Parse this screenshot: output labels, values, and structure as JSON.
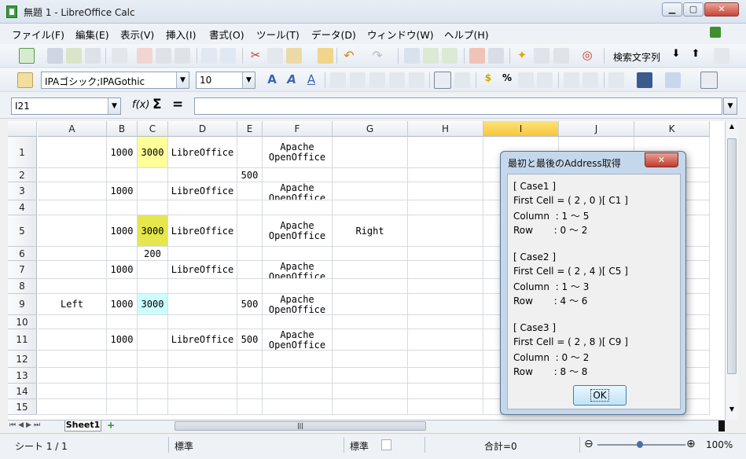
{
  "window": {
    "title": "無題 1 - LibreOffice Calc",
    "minimize": "▁",
    "maximize": "▢",
    "close": "✕"
  },
  "menu": [
    "ファイル(F)",
    "編集(E)",
    "表示(V)",
    "挿入(I)",
    "書式(O)",
    "ツール(T)",
    "データ(D)",
    "ウィンドウ(W)",
    "ヘルプ(H)"
  ],
  "toolbar": {
    "search_label": "検索文字列"
  },
  "format_bar": {
    "font_name": "IPAゴシック;IPAGothic",
    "font_size": "10"
  },
  "formula_bar": {
    "name_box": "I21",
    "fx": "f(x)",
    "sum": "Σ",
    "equals": "=",
    "content": ""
  },
  "columns": [
    "A",
    "B",
    "C",
    "D",
    "E",
    "F",
    "G",
    "H",
    "I",
    "J",
    "K"
  ],
  "selected_column": "I",
  "rows": [
    "1",
    "2",
    "3",
    "4",
    "5",
    "6",
    "7",
    "8",
    "9",
    "10",
    "11",
    "12",
    "13",
    "14",
    "15"
  ],
  "cells": {
    "B1": "1000",
    "C1": "3000",
    "D1": "LibreOffice",
    "F1": "Apache\nOpenOffice",
    "E2": "500",
    "B3": "1000",
    "D3": "LibreOffice",
    "F3": "Apache\nOpenOffice",
    "B5": "1000",
    "C5": "3000",
    "D5": "LibreOffice",
    "F5": "Apache\nOpenOffice",
    "G5": "Right",
    "C6": "200",
    "B7": "1000",
    "D7": "LibreOffice",
    "F7": "Apache\nOpenOffice",
    "A9": "Left",
    "B9": "1000",
    "C9": "3000",
    "E9": "500",
    "F9": "Apache\nOpenOffice",
    "B11": "1000",
    "D11": "LibreOffice",
    "E11": "500",
    "F11": "Apache\nOpenOffice"
  },
  "cell_colors": {
    "C1": "#ffff99",
    "C5": "#e6e64d",
    "C9": "#ccffff"
  },
  "dialog": {
    "title": "最初と最後のAddress取得",
    "close": "✕",
    "lines": [
      "[ Case1 ]",
      "First Cell = ( 2 , 0 )[ C1 ]",
      "Column  : 1 ～ 5",
      "Row       : 0 ～ 2",
      "",
      "[ Case2 ]",
      "First Cell = ( 2 , 4 )[ C5 ]",
      "Column  : 1 ～ 3",
      "Row       : 4 ～ 6",
      "",
      "[ Case3 ]",
      "First Cell = ( 2 , 8 )[ C9 ]",
      "Column  : 0 ～ 2",
      "Row       : 8 ～ 8"
    ],
    "ok": "OK"
  },
  "sheet_tabs": {
    "active": "Sheet1",
    "add": "+"
  },
  "status": {
    "sheet": "シート 1 / 1",
    "style": "標準",
    "mode": "標準",
    "sum": "合計=0",
    "zoom": "100%",
    "zoom_minus": "⊖",
    "zoom_plus": "⊕"
  }
}
